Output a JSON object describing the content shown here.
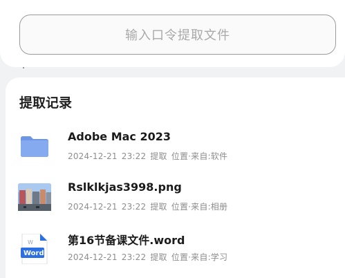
{
  "extract": {
    "placeholder": "输入口令提取文件"
  },
  "records_section": {
    "title": "提取记录",
    "items": [
      {
        "name": "Adobe Mac 2023",
        "date": "2024-12-21",
        "time": "23:22",
        "action": "提取",
        "location": "位置·来自:软件",
        "icon": "folder-icon"
      },
      {
        "name": "Rslklkjas3998.png",
        "date": "2024-12-21",
        "time": "23:22",
        "action": "提取",
        "location": "位置·来自:相册",
        "icon": "image-thumbnail"
      },
      {
        "name": "第16节备课文件.word",
        "date": "2024-12-21",
        "time": "23:22",
        "action": "提取",
        "location": "位置·来自:学习",
        "icon": "word-file-icon"
      }
    ]
  },
  "colors": {
    "folder": "#7fa6ee",
    "word_blue": "#2b6fe0"
  }
}
